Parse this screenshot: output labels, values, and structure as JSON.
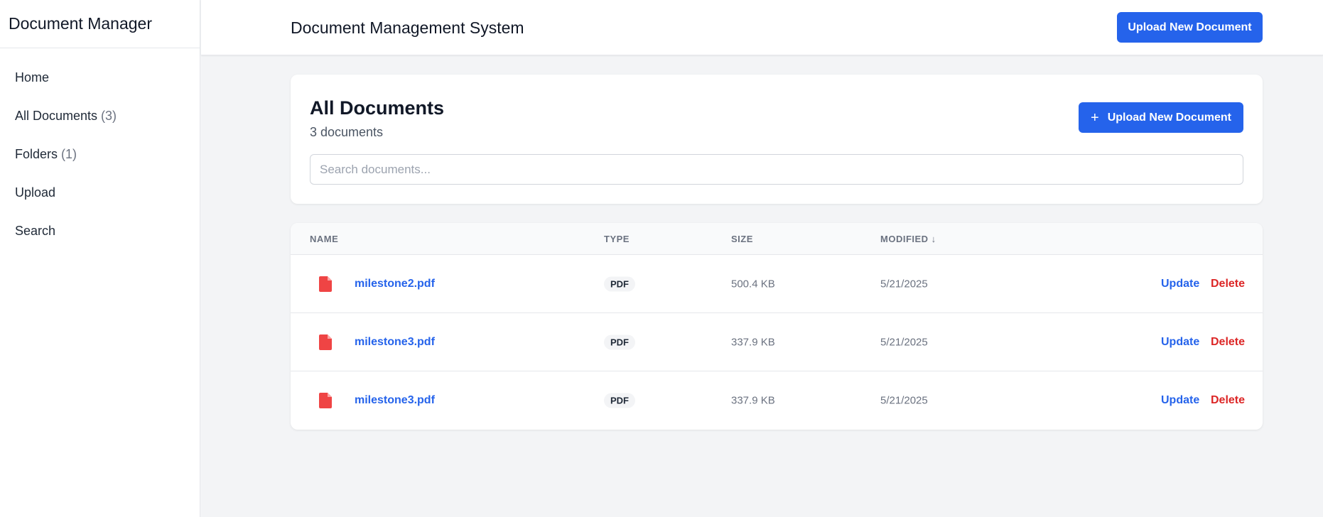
{
  "sidebar": {
    "brand": "Document Manager",
    "items": [
      {
        "label": "Home",
        "count": ""
      },
      {
        "label": "All Documents",
        "count": "(3)"
      },
      {
        "label": "Folders",
        "count": "(1)"
      },
      {
        "label": "Upload",
        "count": ""
      },
      {
        "label": "Search",
        "count": ""
      }
    ]
  },
  "header": {
    "title": "Document Management System",
    "upload_label": "Upload New Document"
  },
  "main": {
    "title": "All Documents",
    "subtitle": "3 documents",
    "upload_label": "Upload New Document",
    "plus_glyph": "+",
    "search_placeholder": "Search documents..."
  },
  "table": {
    "columns": {
      "name": "NAME",
      "type": "TYPE",
      "size": "SIZE",
      "modified": "MODIFIED ↓"
    },
    "rows": [
      {
        "name": "milestone2.pdf",
        "type": "PDF",
        "size": "500.4 KB",
        "modified": "5/21/2025",
        "update": "Update",
        "delete": "Delete",
        "icon": "pdf-file-icon"
      },
      {
        "name": "milestone3.pdf",
        "type": "PDF",
        "size": "337.9 KB",
        "modified": "5/21/2025",
        "update": "Update",
        "delete": "Delete",
        "icon": "pdf-file-icon"
      },
      {
        "name": "milestone3.pdf",
        "type": "PDF",
        "size": "337.9 KB",
        "modified": "5/21/2025",
        "update": "Update",
        "delete": "Delete",
        "icon": "pdf-file-icon"
      }
    ]
  },
  "colors": {
    "primary": "#2563eb",
    "danger": "#dc2626",
    "file_icon": "#ef4444",
    "background": "#f3f4f6"
  }
}
